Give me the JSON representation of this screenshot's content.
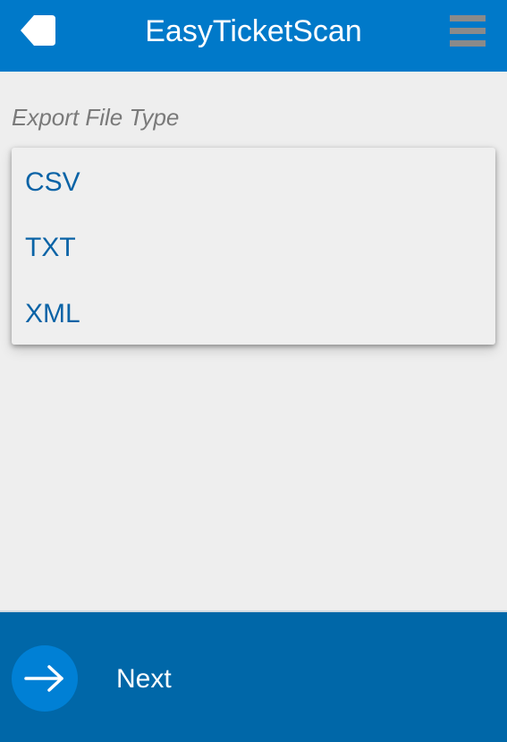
{
  "header": {
    "title": "EasyTicketScan",
    "back_icon": "back-arrow-icon",
    "menu_icon": "hamburger-menu-icon"
  },
  "export": {
    "label": "Export File Type",
    "options": [
      "CSV",
      "TXT",
      "XML"
    ]
  },
  "footer": {
    "next_label": "Next",
    "next_icon": "arrow-right-icon"
  },
  "colors": {
    "header_bg": "#0079c9",
    "footer_bg": "#0067a8",
    "accent_circle": "#0080d5",
    "option_text": "#0a63a6",
    "page_bg": "#eeeeee"
  }
}
